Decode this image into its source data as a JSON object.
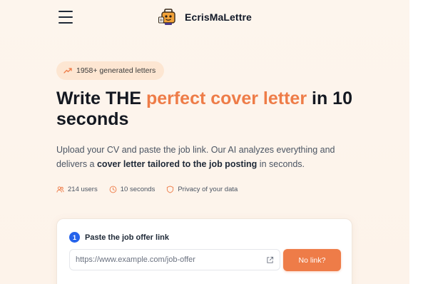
{
  "header": {
    "brand_name": "EcrisMaLettre",
    "menu_icon": "hamburger-menu-icon",
    "logo_icon": "briefcase-mascot-logo"
  },
  "hero": {
    "badge": {
      "icon": "trending-up-icon",
      "text": "1958+ generated letters"
    },
    "title_before": "Write THE ",
    "title_accent": "perfect cover letter",
    "title_after": " in 10 seconds",
    "desc_before": "Upload your CV and paste the job link. Our AI analyzes everything and delivers a ",
    "desc_strong": "cover letter tailored to the job posting",
    "desc_after": " in seconds.",
    "stats": [
      {
        "icon": "users-icon",
        "text": "214 users"
      },
      {
        "icon": "clock-icon",
        "text": "10 seconds"
      },
      {
        "icon": "shield-icon",
        "text": "Privacy of your data"
      }
    ]
  },
  "card": {
    "step_number": "1",
    "step_label": "Paste the job offer link",
    "url_placeholder": "https://www.example.com/job-offer",
    "url_value": "",
    "no_link_button": "No link?"
  },
  "colors": {
    "accent": "#ee7c48",
    "badge_bg": "#fde6d2",
    "step_blue": "#2563eb",
    "page_bg": "#fdf5ed"
  }
}
